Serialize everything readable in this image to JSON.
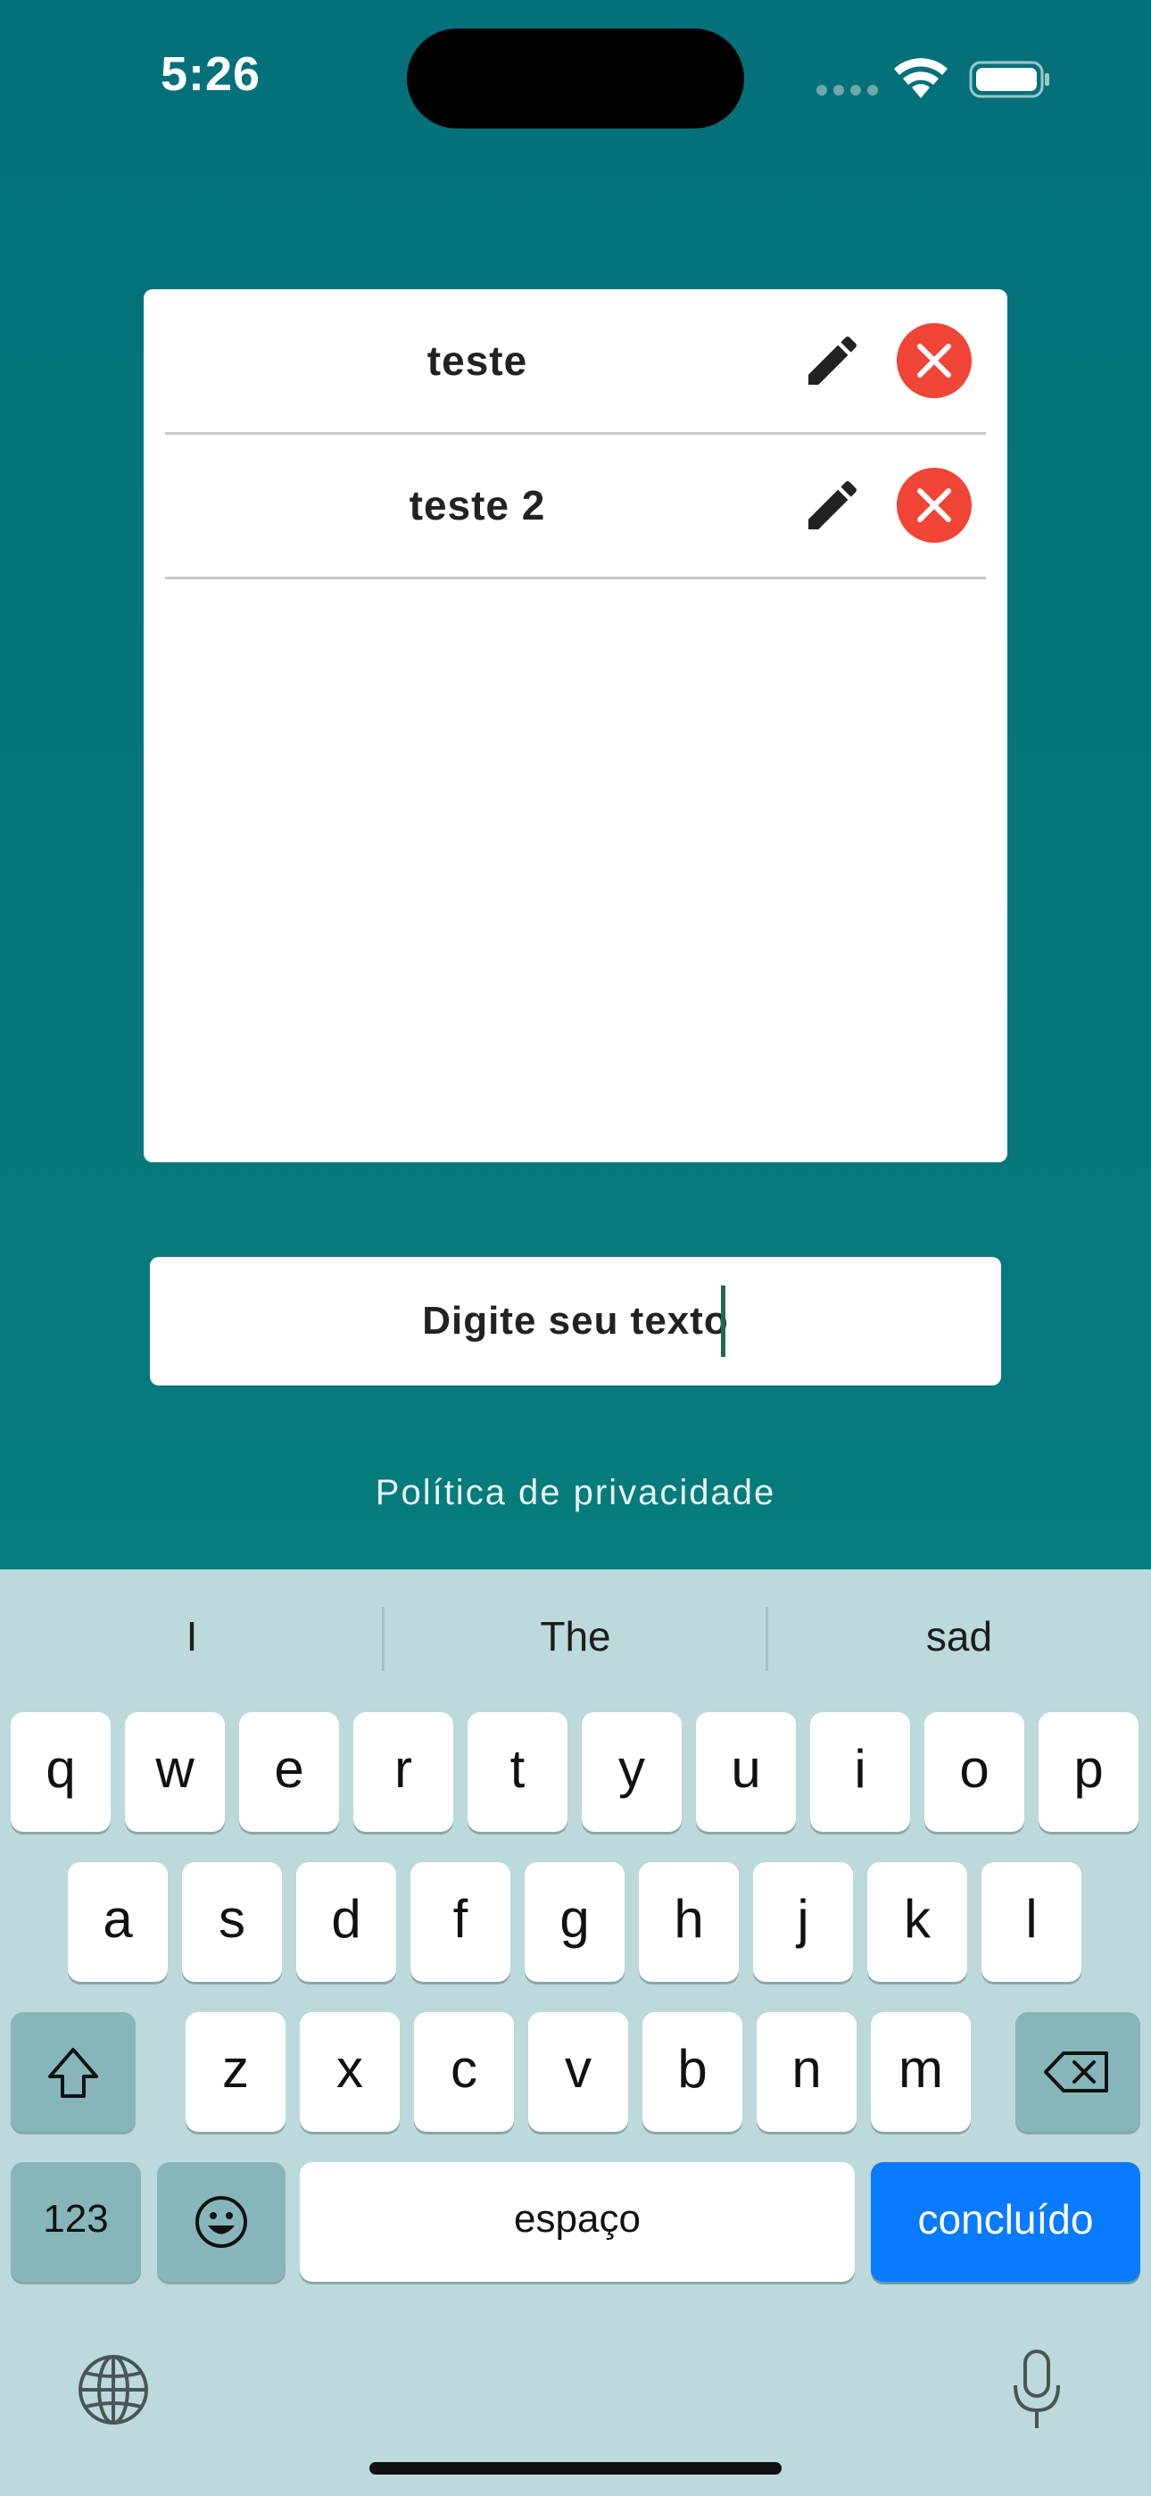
{
  "status": {
    "time": "5:26"
  },
  "list": {
    "items": [
      {
        "label": "teste"
      },
      {
        "label": "teste 2"
      }
    ]
  },
  "input": {
    "value": "Digite seu texto"
  },
  "footer": {
    "privacy": "Política de privacidade"
  },
  "keyboard": {
    "suggestions": [
      "I",
      "The",
      "sad"
    ],
    "row1": [
      "q",
      "w",
      "e",
      "r",
      "t",
      "y",
      "u",
      "i",
      "o",
      "p"
    ],
    "row2": [
      "a",
      "s",
      "d",
      "f",
      "g",
      "h",
      "j",
      "k",
      "l"
    ],
    "row3": [
      "z",
      "x",
      "c",
      "v",
      "b",
      "n",
      "m"
    ],
    "numbers_label": "123",
    "space_label": "espaço",
    "done_label": "concluído"
  },
  "colors": {
    "background": "#04707a",
    "delete": "#f04436",
    "done_key": "#0a7aff"
  },
  "icons": [
    "wifi-icon",
    "battery-icon",
    "edit-icon",
    "close-icon",
    "shift-icon",
    "backspace-icon",
    "emoji-icon",
    "globe-icon",
    "microphone-icon"
  ]
}
